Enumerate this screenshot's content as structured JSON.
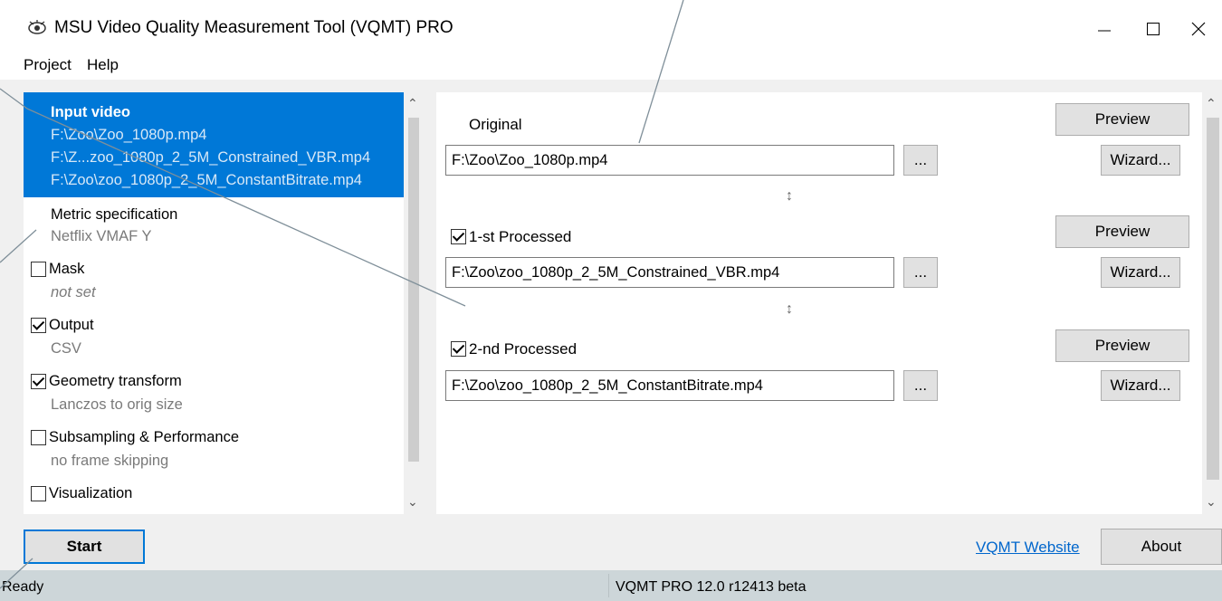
{
  "window": {
    "title": "MSU Video Quality Measurement Tool (VQMT) PRO"
  },
  "menu": {
    "project": "Project",
    "help": "Help"
  },
  "left_list": {
    "input_video": {
      "title": "Input video",
      "lines": [
        "F:\\Zoo\\Zoo_1080p.mp4",
        "F:\\Z...zoo_1080p_2_5M_Constrained_VBR.mp4",
        "F:\\Zoo\\zoo_1080p_2_5M_ConstantBitrate.mp4"
      ]
    },
    "metric": {
      "title": "Metric specification",
      "sub": "Netflix VMAF Y"
    },
    "mask": {
      "title": "Mask",
      "sub": "not set",
      "checked": false
    },
    "output": {
      "title": "Output",
      "sub": "CSV",
      "checked": true
    },
    "geometry": {
      "title": "Geometry transform",
      "sub": "Lanczos to orig size",
      "checked": true
    },
    "subsampling": {
      "title": "Subsampling & Performance",
      "sub": "no frame skipping",
      "checked": false
    },
    "visualization": {
      "title": "Visualization",
      "checked": false
    }
  },
  "inputs": {
    "original": {
      "label": "Original",
      "path": "F:\\Zoo\\Zoo_1080p.mp4"
    },
    "processed1": {
      "label": "1-st Processed",
      "path": "F:\\Zoo\\zoo_1080p_2_5M_Constrained_VBR.mp4",
      "checked": true
    },
    "processed2": {
      "label": "2-nd Processed",
      "path": "F:\\Zoo\\zoo_1080p_2_5M_ConstantBitrate.mp4",
      "checked": true
    },
    "preview_label": "Preview",
    "browse_label": "...",
    "wizard_label": "Wizard...",
    "swap_glyph": "↕"
  },
  "bottom": {
    "start_label": "Start",
    "website_link": "VQMT Website",
    "about_label": "About"
  },
  "status": {
    "left": "Ready",
    "right": "VQMT PRO 12.0 r12413 beta"
  },
  "colors": {
    "selection": "#0078d7",
    "workspace": "#f0f0f0",
    "statusbar": "#cdd6d9",
    "link": "#0066cc"
  }
}
